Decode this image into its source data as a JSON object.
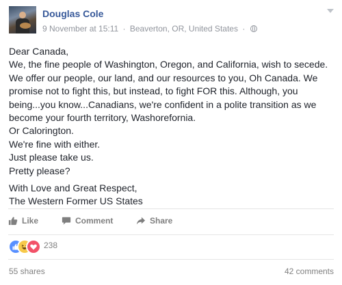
{
  "post": {
    "author": "Douglas Cole",
    "date": "9 November at 15:11",
    "separator": "·",
    "location": "Beaverton, OR, United States",
    "body": [
      "Dear Canada,",
      "We, the fine people of Washington, Oregon, and California, wish to secede. We offer our people, our land, and our resources to you, Oh Canada. We promise not to fight this, but instead, to fight FOR this. Although, you being...you know...Canadians, we're confident in a polite transition as we become your fourth territory, Washorefornia.",
      "Or Calorington.",
      "We're fine with either.",
      "Just please take us.",
      "Pretty please?"
    ],
    "signoff": [
      "With Love and Great Respect,",
      "The Western Former US States"
    ]
  },
  "actions": {
    "like": "Like",
    "comment": "Comment",
    "share": "Share"
  },
  "stats": {
    "reaction_count": "238",
    "shares": "55 shares",
    "comments": "42 comments"
  },
  "colors": {
    "author_blue": "#365899",
    "like_reaction": "#5890ff",
    "haha_reaction": "#f7c94a",
    "love_reaction": "#f25268"
  },
  "icons": {
    "privacy": "globe-icon",
    "menu": "chevron-down-icon",
    "like": "thumbs-up-icon",
    "comment": "comment-bubble-icon",
    "share": "share-arrow-icon"
  }
}
